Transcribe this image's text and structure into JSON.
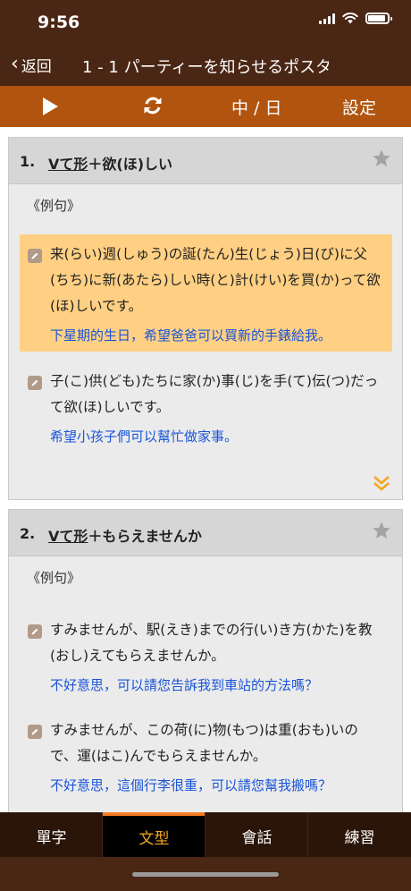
{
  "status": {
    "time": "9:56",
    "battery_level": 0.9
  },
  "nav": {
    "back_label": "返回",
    "title": "1 - 1 パーティーを知らせるポスター"
  },
  "toolbar": {
    "lang_label": "中 / 日",
    "settings_label": "設定"
  },
  "grammar_items": [
    {
      "number": "1.",
      "pattern": "Vて形",
      "suffix": "＋欲(ほ)しい",
      "section_label": "《例句》",
      "examples": [
        {
          "jp": "来(らい)週(しゅう)の誕(たん)生(じょう)日(び)に父(ちち)に新(あたら)しい時(と)計(けい)を買(か)って欲(ほ)しいです。",
          "zh": "下星期的生日，希望爸爸可以買新的手錶給我。",
          "highlighted": true
        },
        {
          "jp": "子(こ)供(ども)たちに家(か)事(じ)を手(て)伝(つ)だって欲(ほ)しいです。",
          "zh": "希望小孩子們可以幫忙做家事。",
          "highlighted": false
        }
      ]
    },
    {
      "number": "2.",
      "pattern": "Vて形",
      "suffix": "＋もらえませんか",
      "section_label": "《例句》",
      "examples": [
        {
          "jp": "すみませんが、駅(えき)までの行(い)き方(かた)を教(おし)えてもらえませんか。",
          "zh": "不好意思，可以請您告訴我到車站的方法嗎？",
          "highlighted": false
        },
        {
          "jp": "すみませんが、この荷(に)物(もつ)は重(おも)いので、運(はこ)んでもらえませんか。",
          "zh": "不好意思，這個行李很重，可以請您幫我搬嗎？",
          "highlighted": false
        }
      ]
    }
  ],
  "tabs": [
    {
      "label": "單字",
      "active": false
    },
    {
      "label": "文型",
      "active": true
    },
    {
      "label": "會話",
      "active": false
    },
    {
      "label": "練習",
      "active": false
    }
  ],
  "colors": {
    "header_bg": "#4a2614",
    "toolbar_bg": "#b0540f",
    "highlight": "#ffd083",
    "translation": "#1a54d8",
    "tab_accent": "#f47c20"
  }
}
